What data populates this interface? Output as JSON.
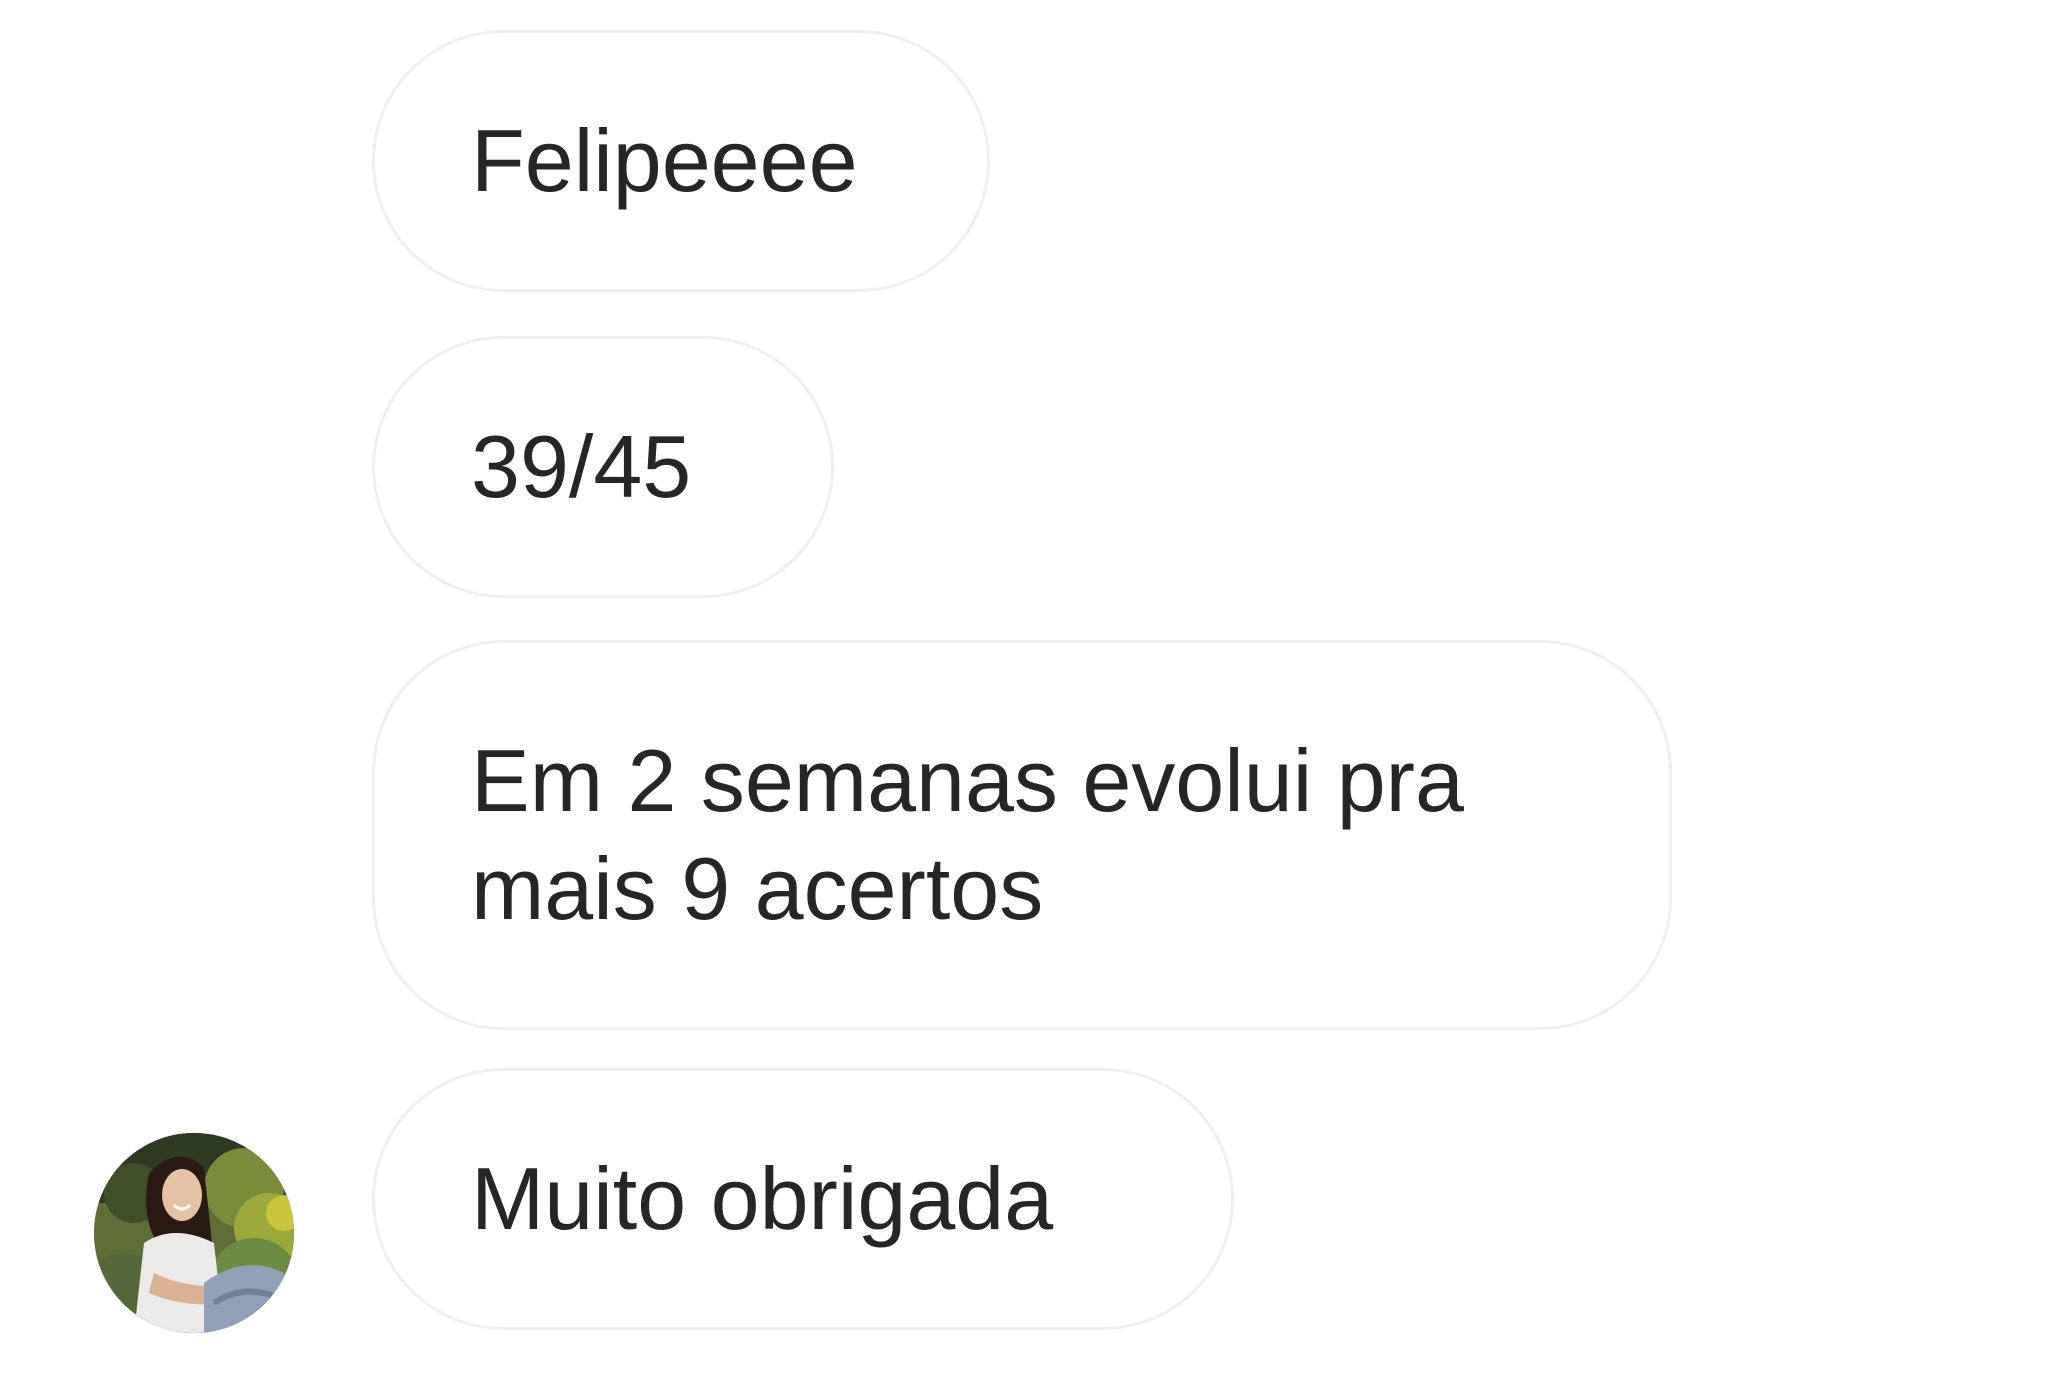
{
  "messages": [
    {
      "text": "Felipeeee"
    },
    {
      "text": "39/45"
    },
    {
      "text": "Em 2 semanas evolui pra mais 9 acertos"
    },
    {
      "text": "Muito obrigada"
    }
  ],
  "avatar": {
    "icon": "profile-photo",
    "alt": "sender avatar"
  },
  "colors": {
    "background": "#ffffff",
    "bubble_border": "#efefef",
    "text": "#262626"
  }
}
